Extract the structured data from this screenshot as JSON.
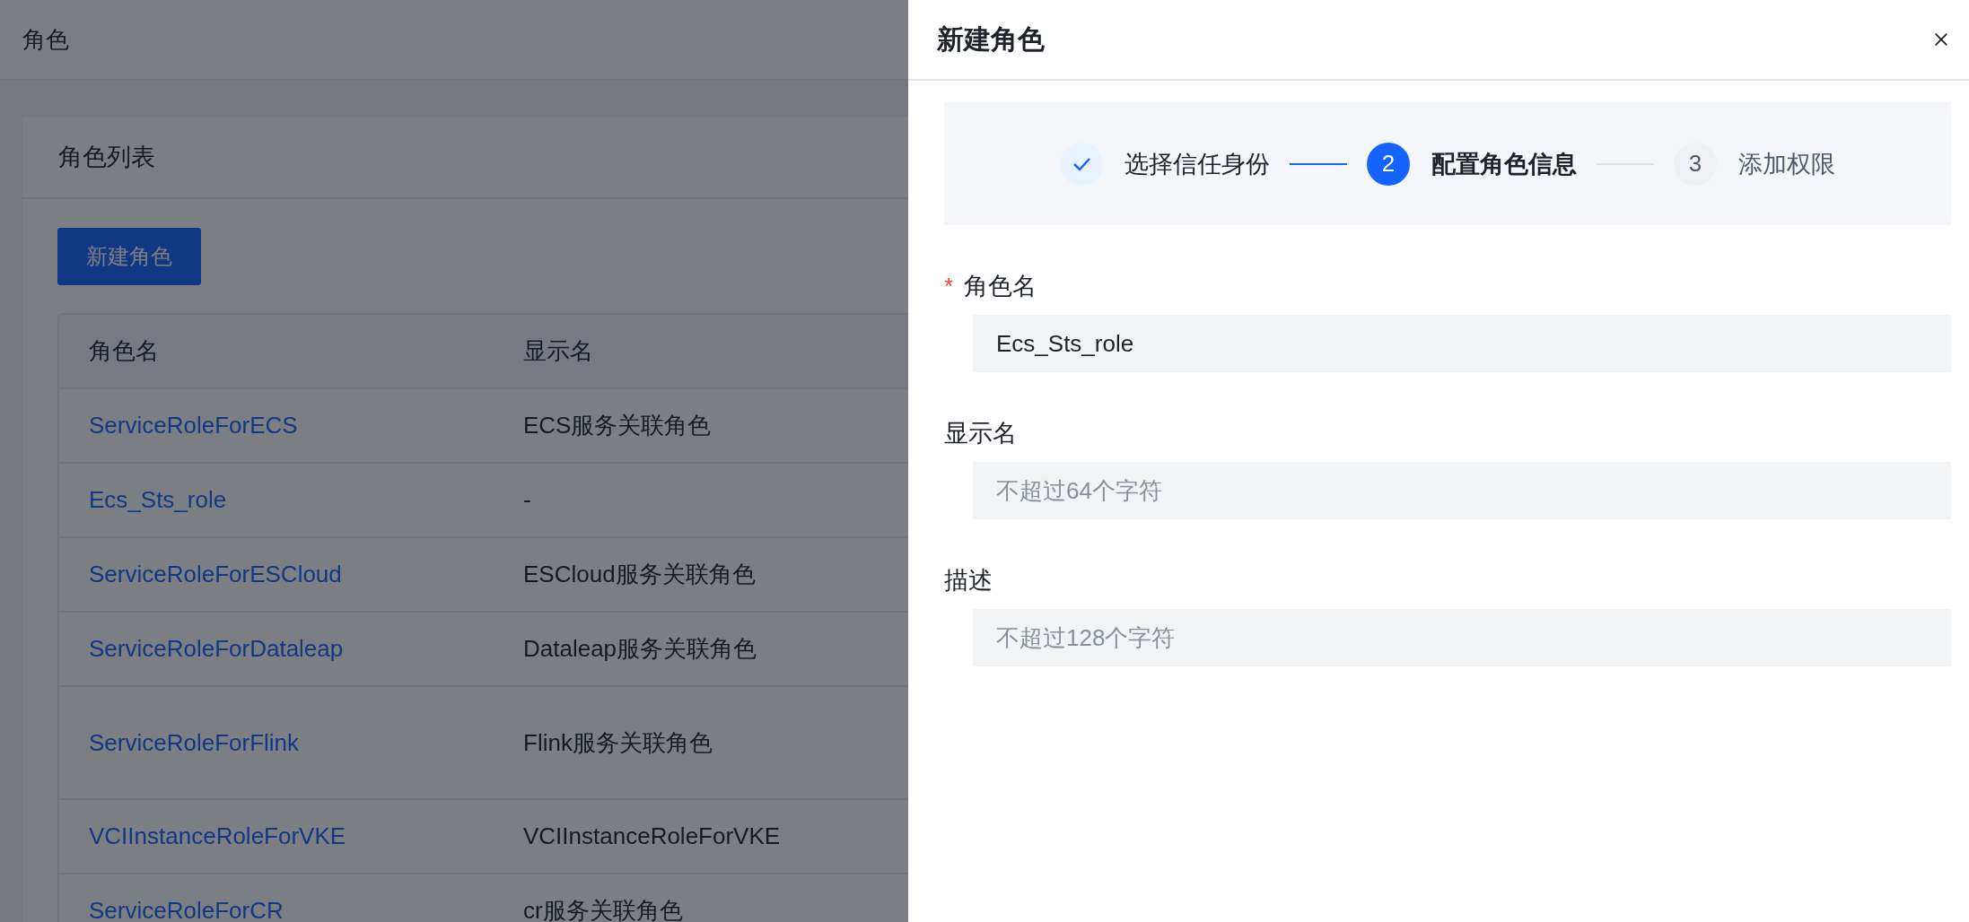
{
  "page": {
    "title": "角色"
  },
  "card": {
    "title": "角色列表",
    "create_button": "新建角色",
    "table": {
      "columns": [
        "角色名",
        "显示名"
      ],
      "rows": [
        {
          "name": "ServiceRoleForECS",
          "display_name": "ECS服务关联角色",
          "tall": false
        },
        {
          "name": "Ecs_Sts_role",
          "display_name": "-",
          "tall": false
        },
        {
          "name": "ServiceRoleForESCloud",
          "display_name": "ESCloud服务关联角色",
          "tall": false
        },
        {
          "name": "ServiceRoleForDataleap",
          "display_name": "Dataleap服务关联角色",
          "tall": false
        },
        {
          "name": "ServiceRoleForFlink",
          "display_name": "Flink服务关联角色",
          "tall": true
        },
        {
          "name": "VCIInstanceRoleForVKE",
          "display_name": "VCIInstanceRoleForVKE",
          "tall": false
        },
        {
          "name": "ServiceRoleForCR",
          "display_name": "cr服务关联角色",
          "tall": false
        }
      ]
    }
  },
  "drawer": {
    "title": "新建角色",
    "steps": [
      {
        "label": "选择信任身份",
        "done": true,
        "selected": false
      },
      {
        "number": "2",
        "label": "配置角色信息",
        "done": false,
        "selected": true
      },
      {
        "number": "3",
        "label": "添加权限",
        "done": false,
        "selected": false
      }
    ],
    "fields": [
      {
        "label": "角色名",
        "required_mark": "*",
        "value": "Ecs_Sts_role"
      },
      {
        "label": "显示名",
        "placeholder": "不超过64个字符"
      },
      {
        "label": "描述",
        "placeholder": "不超过128个字符"
      }
    ]
  }
}
